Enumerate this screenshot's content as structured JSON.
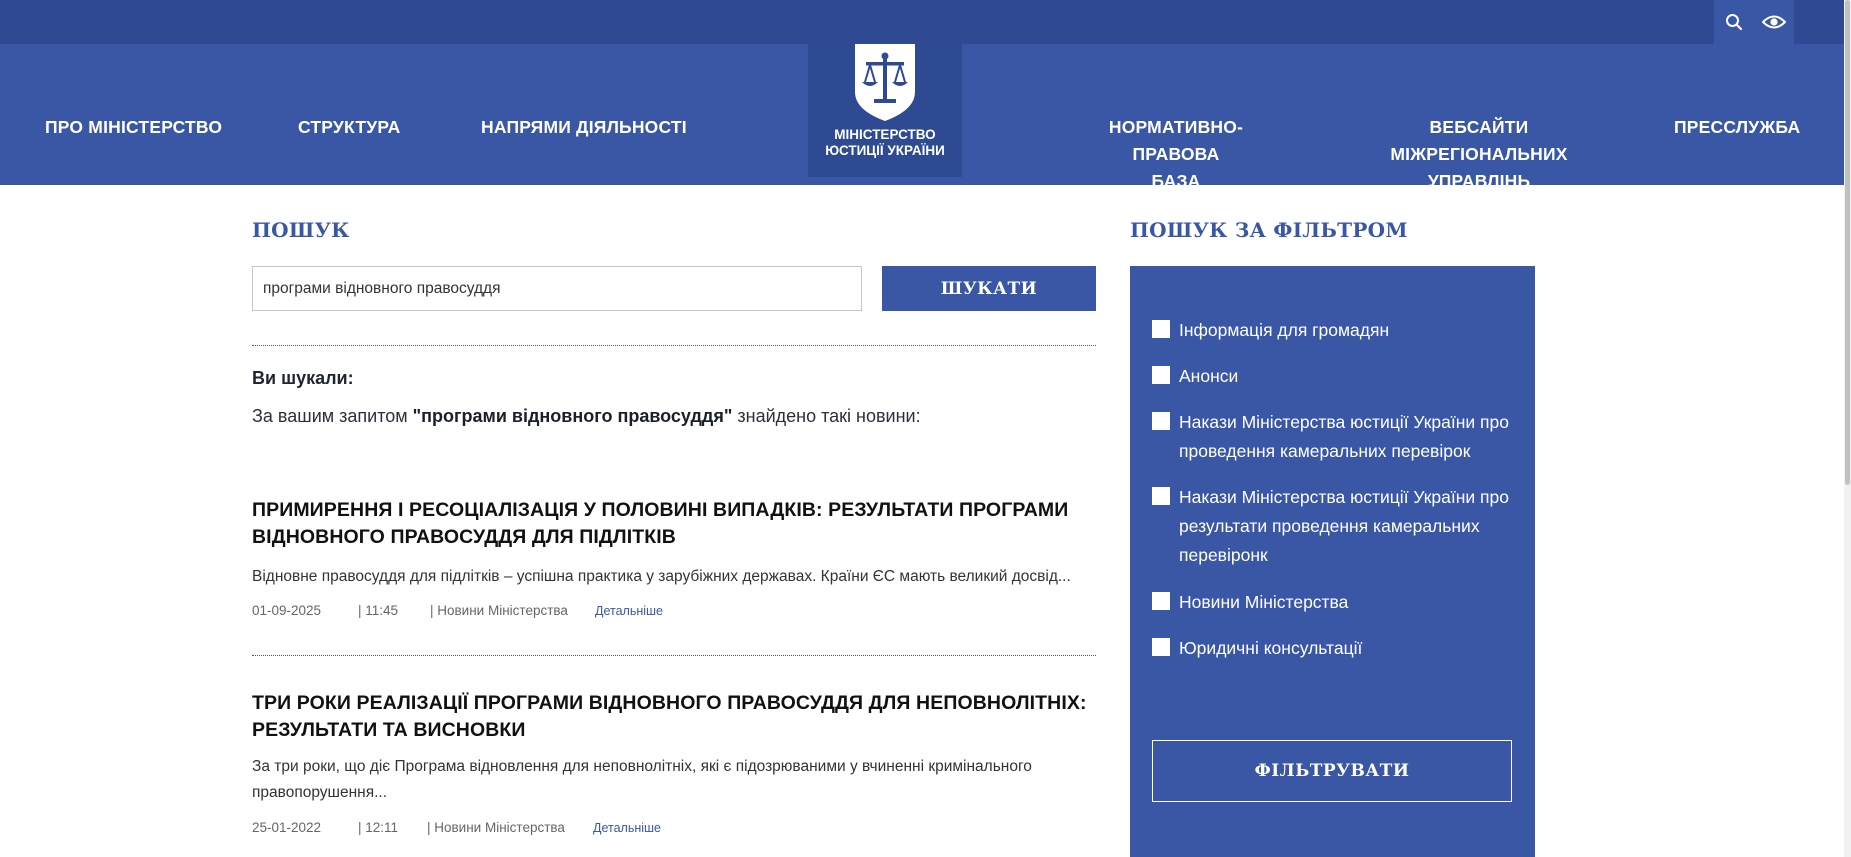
{
  "header": {
    "nav_left": [
      "ПРО МІНІСТЕРСТВО",
      "СТРУКТУРА",
      "НАПРЯМИ ДІЯЛЬНОСТІ"
    ],
    "nav_right": [
      "НОРМАТИВНО-ПРАВОВА\nБАЗА",
      "ВЕБСАЙТИ МІЖРЕГІОНАЛЬНИХ\nУПРАВЛІНЬ",
      "ПРЕССЛУЖБА"
    ],
    "logo_line1": "МІНІСТЕРСТВО",
    "logo_line2": "ЮСТИЦІЇ УКРАЇНИ",
    "icons": [
      "search-icon",
      "eye-icon"
    ]
  },
  "search": {
    "title": "ПОШУК",
    "query": "програми відновного правосуддя",
    "button": "ШУКАТИ",
    "you_searched": "Ви шукали:",
    "result_prefix": "За вашим запитом ",
    "result_query": "\"програми відновного правосуддя\"",
    "result_suffix": " знайдено такі новини:"
  },
  "results": [
    {
      "title": "ПРИМИРЕННЯ І РЕСОЦІАЛІЗАЦІЯ У ПОЛОВИНІ ВИПАДКІВ: РЕЗУЛЬТАТИ ПРОГРАМИ ВІДНОВНОГО ПРАВОСУДДЯ ДЛЯ ПІДЛІТКІВ",
      "excerpt": "Відновне правосуддя для підлітків – успішна практика у зарубіжних державах. Країни ЄС мають великий досвід...",
      "date": "01-09-2025",
      "time": "| 11:45",
      "category": "| Новини Міністерства",
      "more": "Детальніше"
    },
    {
      "title": "ТРИ РОКИ РЕАЛІЗАЦІЇ ПРОГРАМИ ВІДНОВНОГО ПРАВОСУДДЯ ДЛЯ НЕПОВНОЛІТНІХ: РЕЗУЛЬТАТИ ТА ВИСНОВКИ",
      "excerpt": "За три роки, що діє Програма відновлення для неповнолітніх, які є підозрюваними у вчиненні кримінального правопорушення...",
      "date": "25-01-2022",
      "time": "| 12:11",
      "category": "| Новини Міністерства",
      "more": "Детальніше"
    }
  ],
  "filter": {
    "title": "ПОШУК ЗА ФІЛЬТРОМ",
    "options": [
      "Інформація для громадян",
      "Анонси",
      "Накази Міністерства юстиції України про проведення камеральних перевірок",
      "Накази Міністерства юстиції України про результати проведення камеральних перевіронк",
      "Новини Міністерства",
      "Юридичні консультації"
    ],
    "button": "ФІЛЬТРУВАТИ"
  },
  "colors": {
    "primary": "#3a57a6",
    "topbar": "#2f4a93",
    "logo_bg": "#2d4a93"
  }
}
